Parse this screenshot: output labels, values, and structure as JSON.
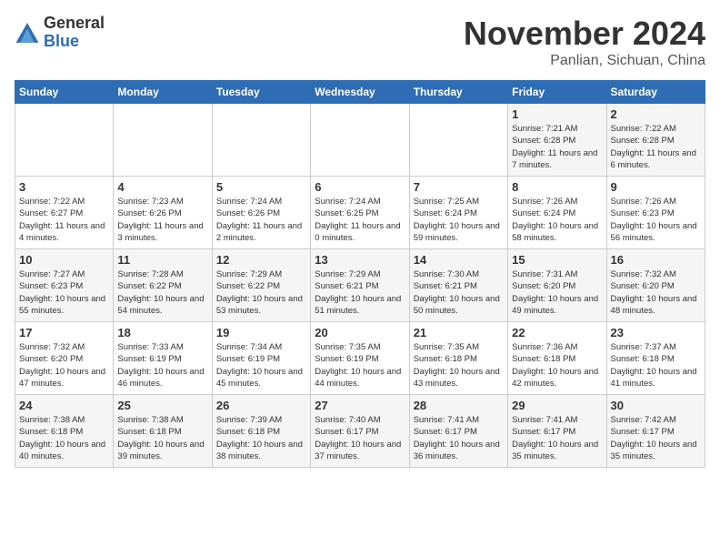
{
  "header": {
    "logo_general": "General",
    "logo_blue": "Blue",
    "month_title": "November 2024",
    "location": "Panlian, Sichuan, China"
  },
  "weekdays": [
    "Sunday",
    "Monday",
    "Tuesday",
    "Wednesday",
    "Thursday",
    "Friday",
    "Saturday"
  ],
  "weeks": [
    [
      {
        "day": "",
        "info": ""
      },
      {
        "day": "",
        "info": ""
      },
      {
        "day": "",
        "info": ""
      },
      {
        "day": "",
        "info": ""
      },
      {
        "day": "",
        "info": ""
      },
      {
        "day": "1",
        "info": "Sunrise: 7:21 AM\nSunset: 6:28 PM\nDaylight: 11 hours and 7 minutes."
      },
      {
        "day": "2",
        "info": "Sunrise: 7:22 AM\nSunset: 6:28 PM\nDaylight: 11 hours and 6 minutes."
      }
    ],
    [
      {
        "day": "3",
        "info": "Sunrise: 7:22 AM\nSunset: 6:27 PM\nDaylight: 11 hours and 4 minutes."
      },
      {
        "day": "4",
        "info": "Sunrise: 7:23 AM\nSunset: 6:26 PM\nDaylight: 11 hours and 3 minutes."
      },
      {
        "day": "5",
        "info": "Sunrise: 7:24 AM\nSunset: 6:26 PM\nDaylight: 11 hours and 2 minutes."
      },
      {
        "day": "6",
        "info": "Sunrise: 7:24 AM\nSunset: 6:25 PM\nDaylight: 11 hours and 0 minutes."
      },
      {
        "day": "7",
        "info": "Sunrise: 7:25 AM\nSunset: 6:24 PM\nDaylight: 10 hours and 59 minutes."
      },
      {
        "day": "8",
        "info": "Sunrise: 7:26 AM\nSunset: 6:24 PM\nDaylight: 10 hours and 58 minutes."
      },
      {
        "day": "9",
        "info": "Sunrise: 7:26 AM\nSunset: 6:23 PM\nDaylight: 10 hours and 56 minutes."
      }
    ],
    [
      {
        "day": "10",
        "info": "Sunrise: 7:27 AM\nSunset: 6:23 PM\nDaylight: 10 hours and 55 minutes."
      },
      {
        "day": "11",
        "info": "Sunrise: 7:28 AM\nSunset: 6:22 PM\nDaylight: 10 hours and 54 minutes."
      },
      {
        "day": "12",
        "info": "Sunrise: 7:29 AM\nSunset: 6:22 PM\nDaylight: 10 hours and 53 minutes."
      },
      {
        "day": "13",
        "info": "Sunrise: 7:29 AM\nSunset: 6:21 PM\nDaylight: 10 hours and 51 minutes."
      },
      {
        "day": "14",
        "info": "Sunrise: 7:30 AM\nSunset: 6:21 PM\nDaylight: 10 hours and 50 minutes."
      },
      {
        "day": "15",
        "info": "Sunrise: 7:31 AM\nSunset: 6:20 PM\nDaylight: 10 hours and 49 minutes."
      },
      {
        "day": "16",
        "info": "Sunrise: 7:32 AM\nSunset: 6:20 PM\nDaylight: 10 hours and 48 minutes."
      }
    ],
    [
      {
        "day": "17",
        "info": "Sunrise: 7:32 AM\nSunset: 6:20 PM\nDaylight: 10 hours and 47 minutes."
      },
      {
        "day": "18",
        "info": "Sunrise: 7:33 AM\nSunset: 6:19 PM\nDaylight: 10 hours and 46 minutes."
      },
      {
        "day": "19",
        "info": "Sunrise: 7:34 AM\nSunset: 6:19 PM\nDaylight: 10 hours and 45 minutes."
      },
      {
        "day": "20",
        "info": "Sunrise: 7:35 AM\nSunset: 6:19 PM\nDaylight: 10 hours and 44 minutes."
      },
      {
        "day": "21",
        "info": "Sunrise: 7:35 AM\nSunset: 6:18 PM\nDaylight: 10 hours and 43 minutes."
      },
      {
        "day": "22",
        "info": "Sunrise: 7:36 AM\nSunset: 6:18 PM\nDaylight: 10 hours and 42 minutes."
      },
      {
        "day": "23",
        "info": "Sunrise: 7:37 AM\nSunset: 6:18 PM\nDaylight: 10 hours and 41 minutes."
      }
    ],
    [
      {
        "day": "24",
        "info": "Sunrise: 7:38 AM\nSunset: 6:18 PM\nDaylight: 10 hours and 40 minutes."
      },
      {
        "day": "25",
        "info": "Sunrise: 7:38 AM\nSunset: 6:18 PM\nDaylight: 10 hours and 39 minutes."
      },
      {
        "day": "26",
        "info": "Sunrise: 7:39 AM\nSunset: 6:18 PM\nDaylight: 10 hours and 38 minutes."
      },
      {
        "day": "27",
        "info": "Sunrise: 7:40 AM\nSunset: 6:17 PM\nDaylight: 10 hours and 37 minutes."
      },
      {
        "day": "28",
        "info": "Sunrise: 7:41 AM\nSunset: 6:17 PM\nDaylight: 10 hours and 36 minutes."
      },
      {
        "day": "29",
        "info": "Sunrise: 7:41 AM\nSunset: 6:17 PM\nDaylight: 10 hours and 35 minutes."
      },
      {
        "day": "30",
        "info": "Sunrise: 7:42 AM\nSunset: 6:17 PM\nDaylight: 10 hours and 35 minutes."
      }
    ]
  ]
}
